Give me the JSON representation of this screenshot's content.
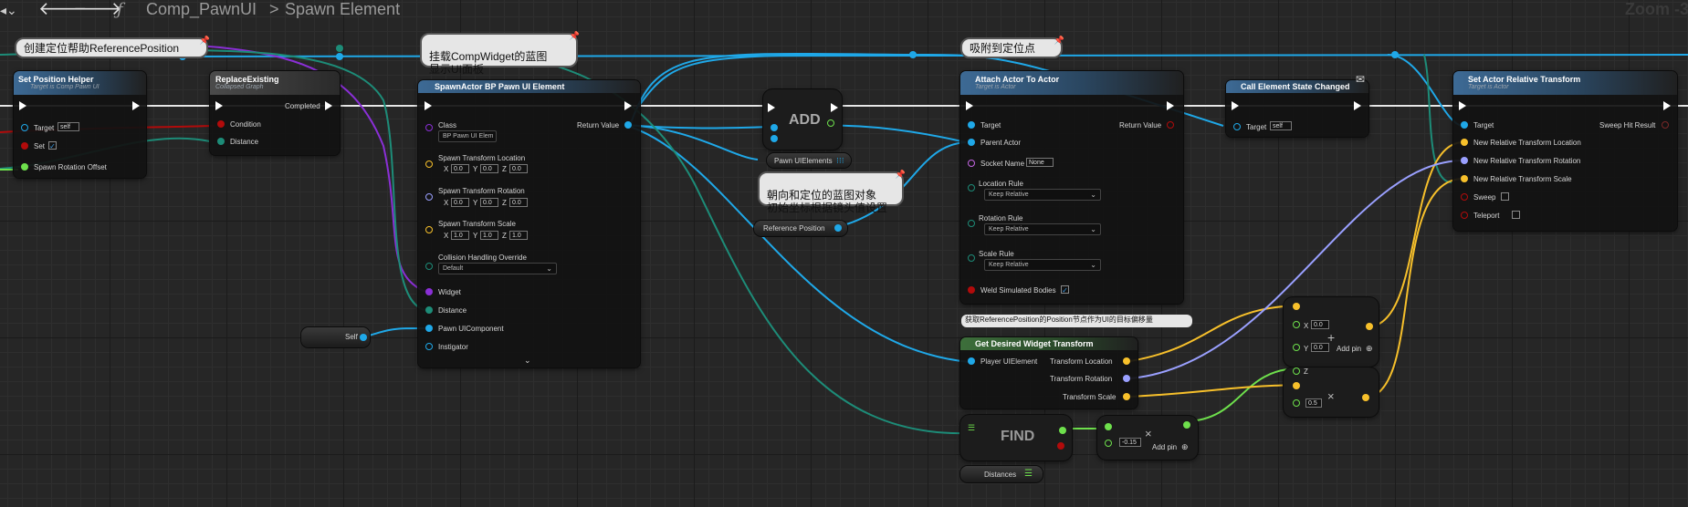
{
  "toolbar": {
    "function_icon": "ƒ",
    "component": "Comp_PawnUI",
    "separator": ">",
    "function": "Spawn Element",
    "zoom": "Zoom -3",
    "back_icon": "arrow-left-icon",
    "forward_icon": "arrow-right-icon"
  },
  "comments": {
    "reference": "创建定位帮助ReferencePosition",
    "widget": "挂载CompWidget的蓝图\n显示UI面板",
    "snap": "吸附到定位点",
    "orient": "朝向和定位的蓝图对象\n初始坐标根据镜头值设置",
    "desired": "获取ReferencePosition的Position节点作为UI的目标偏移量"
  },
  "set_position_helper": {
    "title": "Set Position Helper",
    "subtitle": "Target is Comp Pawn UI",
    "target": "Target",
    "target_value": "self",
    "set": "Set",
    "spawn_rotation_offset": "Spawn Rotation Offset"
  },
  "replace_existing": {
    "title": "ReplaceExisting",
    "subtitle": "Collapsed Graph",
    "completed": "Completed",
    "condition": "Condition",
    "distance": "Distance"
  },
  "spawn_actor": {
    "title": "SpawnActor BP Pawn UI Element",
    "class": "Class",
    "class_value": "BP Pawn UI Elem",
    "return_value": "Return Value",
    "location": "Spawn Transform Location",
    "rotation": "Spawn Transform Rotation",
    "scale": "Spawn Transform Scale",
    "x": "X",
    "y": "Y",
    "z": "Z",
    "zero": "0.0",
    "one": "1.0",
    "collision": "Collision Handling Override",
    "collision_value": "Default",
    "widget": "Widget",
    "distance": "Distance",
    "pawn_ui_component": "Pawn UIComponent",
    "instigator": "Instigator"
  },
  "self_node": {
    "label": "Self"
  },
  "add_node": {
    "label": "ADD"
  },
  "pawn_ui_elements": {
    "label": "Pawn UIElements"
  },
  "reference_position": {
    "label": "Reference Position"
  },
  "attach": {
    "title": "Attach Actor To Actor",
    "subtitle": "Target is Actor",
    "target": "Target",
    "return_value": "Return Value",
    "parent_actor": "Parent Actor",
    "socket_name": "Socket Name",
    "socket_value": "None",
    "location_rule": "Location Rule",
    "rotation_rule": "Rotation Rule",
    "scale_rule": "Scale Rule",
    "keep_relative": "Keep Relative",
    "weld": "Weld Simulated Bodies"
  },
  "call_state": {
    "title": "Call Element State Changed",
    "target": "Target",
    "target_value": "self"
  },
  "set_relative": {
    "title": "Set Actor Relative Transform",
    "subtitle": "Target is Actor",
    "target": "Target",
    "sweep_hit": "Sweep Hit Result",
    "loc": "New Relative Transform Location",
    "rot": "New Relative Transform Rotation",
    "scale": "New Relative Transform Scale",
    "sweep": "Sweep",
    "teleport": "Teleport"
  },
  "desired": {
    "title": "Get Desired Widget Transform",
    "player_ui": "Player UIElement",
    "loc": "Transform Location",
    "rot": "Transform Rotation",
    "scale": "Transform Scale"
  },
  "find": {
    "label": "FIND"
  },
  "distances": {
    "label": "Distances"
  },
  "make_vec": {
    "x": "X",
    "x_value": "0.0",
    "y": "Y",
    "y_value": "0.0",
    "z": "Z",
    "add_pin": "Add pin"
  },
  "mult": {
    "value": "0.5",
    "op": "×"
  },
  "mult2": {
    "value": "-0.15",
    "op": "×",
    "add_pin": "Add pin"
  },
  "colors": {
    "exec": "#ffffff",
    "object": "#1fa8e8",
    "vector": "#f7c02b",
    "rotator": "#9aa0ff",
    "float": "#6ee04c",
    "bool": "#b10b0b",
    "purple": "#8a2fd6",
    "teal": "#1d8c78"
  }
}
